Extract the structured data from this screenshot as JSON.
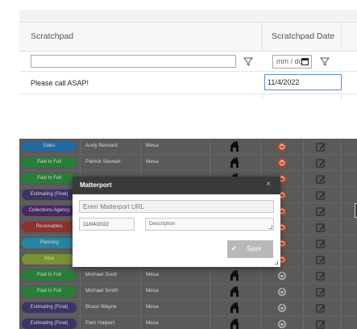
{
  "scratchpad_grid": {
    "columns": {
      "scratchpad": "Scratchpad",
      "scratchpad_date": "Scratchpad Date"
    },
    "filter": {
      "text_value": "",
      "date_placeholder": "mm/dd/yyyy",
      "date_visible": "mm / dc"
    },
    "row": {
      "scratchpad": "Please call ASAP!",
      "scratchpad_date": "11/4/2022"
    }
  },
  "background_grid": {
    "rows": [
      {
        "status": "Sales",
        "status_color": "#2d7fc5",
        "name": "Andy Bernard",
        "city": "Mesa"
      },
      {
        "status": "Paid In Full",
        "status_color": "#2f9a44",
        "name": "Patrick Stewart",
        "city": "Mesa"
      },
      {
        "status": "Paid In Full",
        "status_color": "#2f9a44",
        "name": "",
        "city": ""
      },
      {
        "status": "Estimating (Final)",
        "status_color": "#4b3f7c",
        "name": "",
        "city": ""
      },
      {
        "status": "Collections Agency",
        "status_color": "#5b2f7b",
        "name": "",
        "city": ""
      },
      {
        "status": "Receivables",
        "status_color": "#b03a3a",
        "name": "",
        "city": ""
      },
      {
        "status": "Planning",
        "status_color": "#2fa3c6",
        "name": "",
        "city": ""
      },
      {
        "status": "New",
        "status_color": "#93b33c",
        "name": "",
        "city": ""
      },
      {
        "status": "Paid In Full",
        "status_color": "#2f9a44",
        "name": "Michael Scott",
        "city": "Mesa"
      },
      {
        "status": "Paid In Full",
        "status_color": "#2f9a44",
        "name": "Michael Smith",
        "city": "Mesa"
      },
      {
        "status": "Estimating (Final)",
        "status_color": "#4b3f7c",
        "name": "Bruce Wayne",
        "city": "Mesa"
      },
      {
        "status": "Estimating (Final)",
        "status_color": "#4b3f7c",
        "name": "Pam Halpert",
        "city": "Mesa"
      }
    ]
  },
  "modal": {
    "title": "Matterport",
    "close": "×",
    "url_placeholder": "Enter Matterport URL",
    "date_value": "11/04/2022",
    "description_placeholder": "Description",
    "save_label": "Save"
  },
  "icons": {
    "filter": "filter-icon",
    "calendar": "calendar-icon",
    "house": "house-icon",
    "status": "status-circle-icon",
    "edit": "edit-icon",
    "check": "check-icon"
  },
  "colors": {
    "accent_blue": "#5b8ed6",
    "modal_header": "#3a3a3a",
    "grid_bg": "#6e6e6e",
    "orange": "#e4572e",
    "save_disabled": "#b8b8b8"
  }
}
